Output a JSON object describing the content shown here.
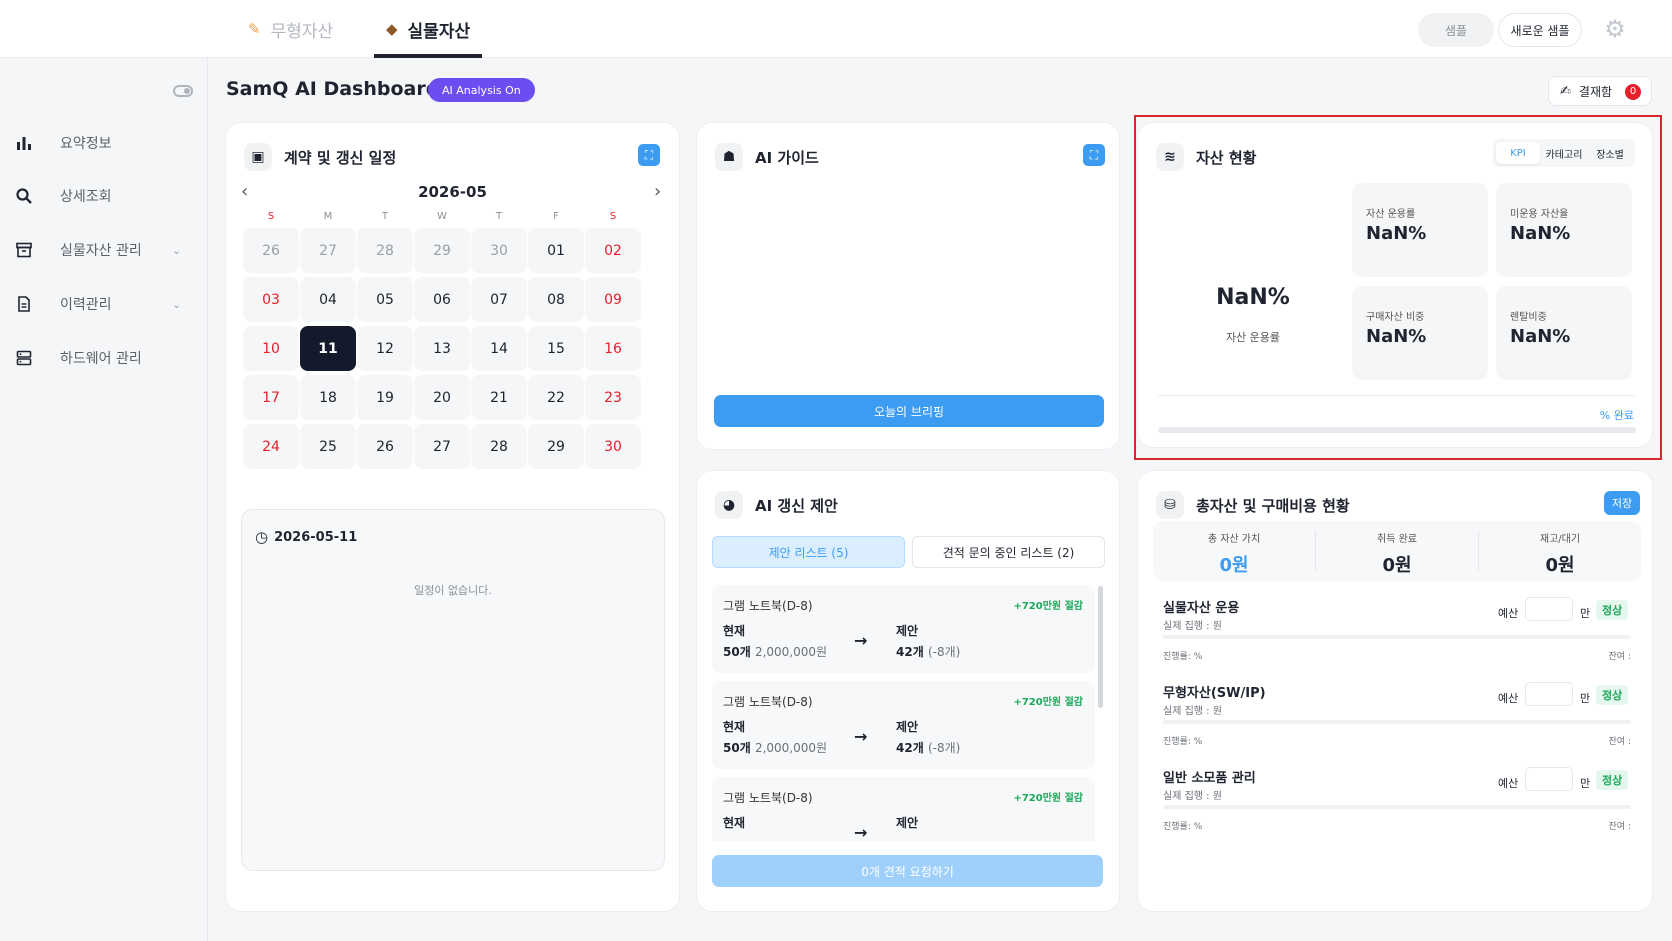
{
  "top_tabs": [
    {
      "label": "무형자산",
      "icon": "pencil-icon"
    },
    {
      "label": "실물자산",
      "icon": "box-icon"
    }
  ],
  "top_actions": {
    "sample": "샘플",
    "new_sample": "새로운 샘플"
  },
  "sidebar": {
    "items": [
      {
        "label": "요약정보",
        "icon": "bar-chart-icon"
      },
      {
        "label": "상세조회",
        "icon": "search-icon"
      },
      {
        "label": "실물자산 관리",
        "icon": "archive-icon"
      },
      {
        "label": "이력관리",
        "icon": "document-icon"
      },
      {
        "label": "하드웨어 관리",
        "icon": "server-icon"
      }
    ]
  },
  "header": {
    "title": "SamQ AI Dashboard",
    "badge": "AI Analysis On",
    "approval_label": "결재함",
    "approval_count": "0"
  },
  "calendar": {
    "title": "계약 및 갱신 일정",
    "month": "2026-05",
    "weekdays": [
      "S",
      "M",
      "T",
      "W",
      "T",
      "F",
      "S"
    ],
    "weeks": [
      [
        "26",
        "27",
        "28",
        "29",
        "30",
        "01",
        "02"
      ],
      [
        "03",
        "04",
        "05",
        "06",
        "07",
        "08",
        "09"
      ],
      [
        "10",
        "11",
        "12",
        "13",
        "14",
        "15",
        "16"
      ],
      [
        "17",
        "18",
        "19",
        "20",
        "21",
        "22",
        "23"
      ],
      [
        "24",
        "25",
        "26",
        "27",
        "28",
        "29",
        "30"
      ]
    ],
    "selected_day": "11",
    "schedule_date": "2026-05-11",
    "empty_text": "일정이 없습니다."
  },
  "ai_guide": {
    "title": "AI 가이드",
    "button": "오늘의 브리핑"
  },
  "asset_status": {
    "title": "자산 현황",
    "tabs": [
      "KPI",
      "카테고리",
      "장소별"
    ],
    "active_tab": "KPI",
    "main_value": "NaN%",
    "main_label": "자산 운용률",
    "kpis": [
      {
        "label": "자산 운용률",
        "value": "NaN%"
      },
      {
        "label": "미운용 자산율",
        "value": "NaN%"
      },
      {
        "label": "구매자산 비중",
        "value": "NaN%"
      },
      {
        "label": "렌탈비중",
        "value": "NaN%"
      }
    ],
    "progress_text": "% 완료"
  },
  "ai_suggestions": {
    "title": "AI 갱신 제안",
    "tabs": [
      "제안 리스트 (5)",
      "견적 문의 중인 리스트 (2)"
    ],
    "items": [
      {
        "title": "그램 노트북(D-8)",
        "saving": "+720만원 절감",
        "current_label": "현재",
        "current_qty": "50개",
        "current_price": "2,000,000원",
        "suggest_label": "제안",
        "suggest_qty": "42개",
        "suggest_diff": "(-8개)"
      },
      {
        "title": "그램 노트북(D-8)",
        "saving": "+720만원 절감",
        "current_label": "현재",
        "current_qty": "50개",
        "current_price": "2,000,000원",
        "suggest_label": "제안",
        "suggest_qty": "42개",
        "suggest_diff": "(-8개)"
      },
      {
        "title": "그램 노트북(D-8)",
        "saving": "+720만원 절감",
        "current_label": "현재",
        "current_qty": "",
        "current_price": "",
        "suggest_label": "제안",
        "suggest_qty": "",
        "suggest_diff": ""
      }
    ],
    "button": "0개 견적 요청하기"
  },
  "totals": {
    "title": "총자산 및 구매비용 현황",
    "save_label": "저장",
    "summary": [
      {
        "label": "총 자산 가치",
        "value": "0원",
        "color": "#3b9cf2"
      },
      {
        "label": "취득 완료",
        "value": "0원",
        "color": "#1f2430"
      },
      {
        "label": "재고/대기",
        "value": "0원",
        "color": "#1f2430"
      }
    ],
    "budgets": [
      {
        "title": "실물자산 운용",
        "sub": "실제 집행 : 원",
        "budget_label": "예산",
        "unit": "만",
        "status": "정상",
        "progress": "진행률: %",
        "remain": "잔여 :"
      },
      {
        "title": "무형자산(SW/IP)",
        "sub": "실제 집행 : 원",
        "budget_label": "예산",
        "unit": "만",
        "status": "정상",
        "progress": "진행률: %",
        "remain": "잔여 :"
      },
      {
        "title": "일반 소모품 관리",
        "sub": "실제 집행 : 원",
        "budget_label": "예산",
        "unit": "만",
        "status": "정상",
        "progress": "진행률: %",
        "remain": "잔여 :"
      }
    ]
  },
  "colors": {
    "accent": "#3b9cf2",
    "badge": "#6c4ef0",
    "danger": "#e5202a",
    "success": "#1ea85a",
    "highlight_border": "#d9262d"
  }
}
